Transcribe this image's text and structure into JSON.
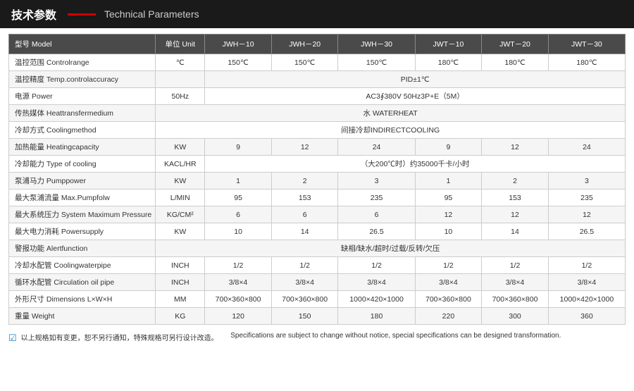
{
  "header": {
    "title_cn": "技术参数",
    "title_en": "Technical Parameters"
  },
  "table": {
    "columns": [
      {
        "id": "param",
        "label_cn": "型号 Model"
      },
      {
        "id": "unit",
        "label_cn": "单位 Unit"
      },
      {
        "id": "jwh10",
        "label_cn": "JWH－10"
      },
      {
        "id": "jwh20",
        "label_cn": "JWH－20"
      },
      {
        "id": "jwh30",
        "label_cn": "JWH－30"
      },
      {
        "id": "jwt10",
        "label_cn": "JWT－10"
      },
      {
        "id": "jwt20",
        "label_cn": "JWT－20"
      },
      {
        "id": "jwt30",
        "label_cn": "JWT－30"
      }
    ],
    "rows": [
      {
        "param": "温控范围 Controlrange",
        "unit": "℃",
        "jwh10": "150℃",
        "jwh20": "150℃",
        "jwh30": "150℃",
        "jwt10": "180℃",
        "jwt20": "180℃",
        "jwt30": "180℃",
        "colspan": false
      },
      {
        "param": "温控精度 Temp.controlaccuracy",
        "unit": "",
        "colspan": true,
        "colspan_value": "PID±1℃",
        "colspan_count": 6
      },
      {
        "param": "电源 Power",
        "unit": "50Hz",
        "colspan": true,
        "colspan_value": "AC3∮380V 50Hz3P+E（5M）",
        "colspan_count": 6
      },
      {
        "param": "传热媒体 Heattransfermedium",
        "unit": "",
        "colspan": true,
        "colspan_value": "水 WATERHEAT",
        "colspan_count": 7
      },
      {
        "param": "冷却方式 Coolingmethod",
        "unit": "",
        "colspan": true,
        "colspan_value": "间接冷却INDIRECTCOOLING",
        "colspan_count": 7
      },
      {
        "param": "加热能量 Heatingcapacity",
        "unit": "KW",
        "jwh10": "9",
        "jwh20": "12",
        "jwh30": "24",
        "jwt10": "9",
        "jwt20": "12",
        "jwt30": "24",
        "colspan": false
      },
      {
        "param": "冷却能力 Type of cooling",
        "unit": "KACL/HR",
        "colspan": true,
        "colspan_value": "（大200℃时）约35000千卡/小时",
        "colspan_count": 6
      },
      {
        "param": "泵浦马力 Pumppower",
        "unit": "KW",
        "jwh10": "1",
        "jwh20": "2",
        "jwh30": "3",
        "jwt10": "1",
        "jwt20": "2",
        "jwt30": "3",
        "colspan": false
      },
      {
        "param": "最大泵浦流量 Max.Pumpfolw",
        "unit": "L/MIN",
        "jwh10": "95",
        "jwh20": "153",
        "jwh30": "235",
        "jwt10": "95",
        "jwt20": "153",
        "jwt30": "235",
        "colspan": false
      },
      {
        "param": "最大系统压力 System Maximum Pressure",
        "unit": "KG/CM²",
        "jwh10": "6",
        "jwh20": "6",
        "jwh30": "6",
        "jwt10": "12",
        "jwt20": "12",
        "jwt30": "12",
        "colspan": false
      },
      {
        "param": "最大电力消耗 Powersupply",
        "unit": "KW",
        "jwh10": "10",
        "jwh20": "14",
        "jwh30": "26.5",
        "jwt10": "10",
        "jwt20": "14",
        "jwt30": "26.5",
        "colspan": false
      },
      {
        "param": "警报功能 Alertfunction",
        "unit": "",
        "colspan": true,
        "colspan_value": "缺相/缺水/超时/过载/反转/欠压",
        "colspan_count": 7
      },
      {
        "param": "冷却水配管 Coolingwaterpipe",
        "unit": "INCH",
        "jwh10": "1/2",
        "jwh20": "1/2",
        "jwh30": "1/2",
        "jwt10": "1/2",
        "jwt20": "1/2",
        "jwt30": "1/2",
        "colspan": false
      },
      {
        "param": "循环水配管 Circulation oil pipe",
        "unit": "INCH",
        "jwh10": "3/8×4",
        "jwh20": "3/8×4",
        "jwh30": "3/8×4",
        "jwt10": "3/8×4",
        "jwt20": "3/8×4",
        "jwt30": "3/8×4",
        "colspan": false
      },
      {
        "param": "外形尺寸 Dimensions L×W×H",
        "unit": "MM",
        "jwh10": "700×360×800",
        "jwh20": "700×360×800",
        "jwh30": "1000×420×1000",
        "jwt10": "700×360×800",
        "jwt20": "700×360×800",
        "jwt30": "1000×420×1000",
        "colspan": false
      },
      {
        "param": "重量 Weight",
        "unit": "KG",
        "jwh10": "120",
        "jwh20": "150",
        "jwh30": "180",
        "jwt10": "220",
        "jwt20": "300",
        "jwt30": "360",
        "colspan": false
      }
    ]
  },
  "footer": {
    "icon": "☑",
    "text_cn": "以上规格如有变更，恕不另行通知，特殊规格可另行设计改造。",
    "text_en": "Specifications are subject to change without notice, special specifications can be designed transformation."
  }
}
